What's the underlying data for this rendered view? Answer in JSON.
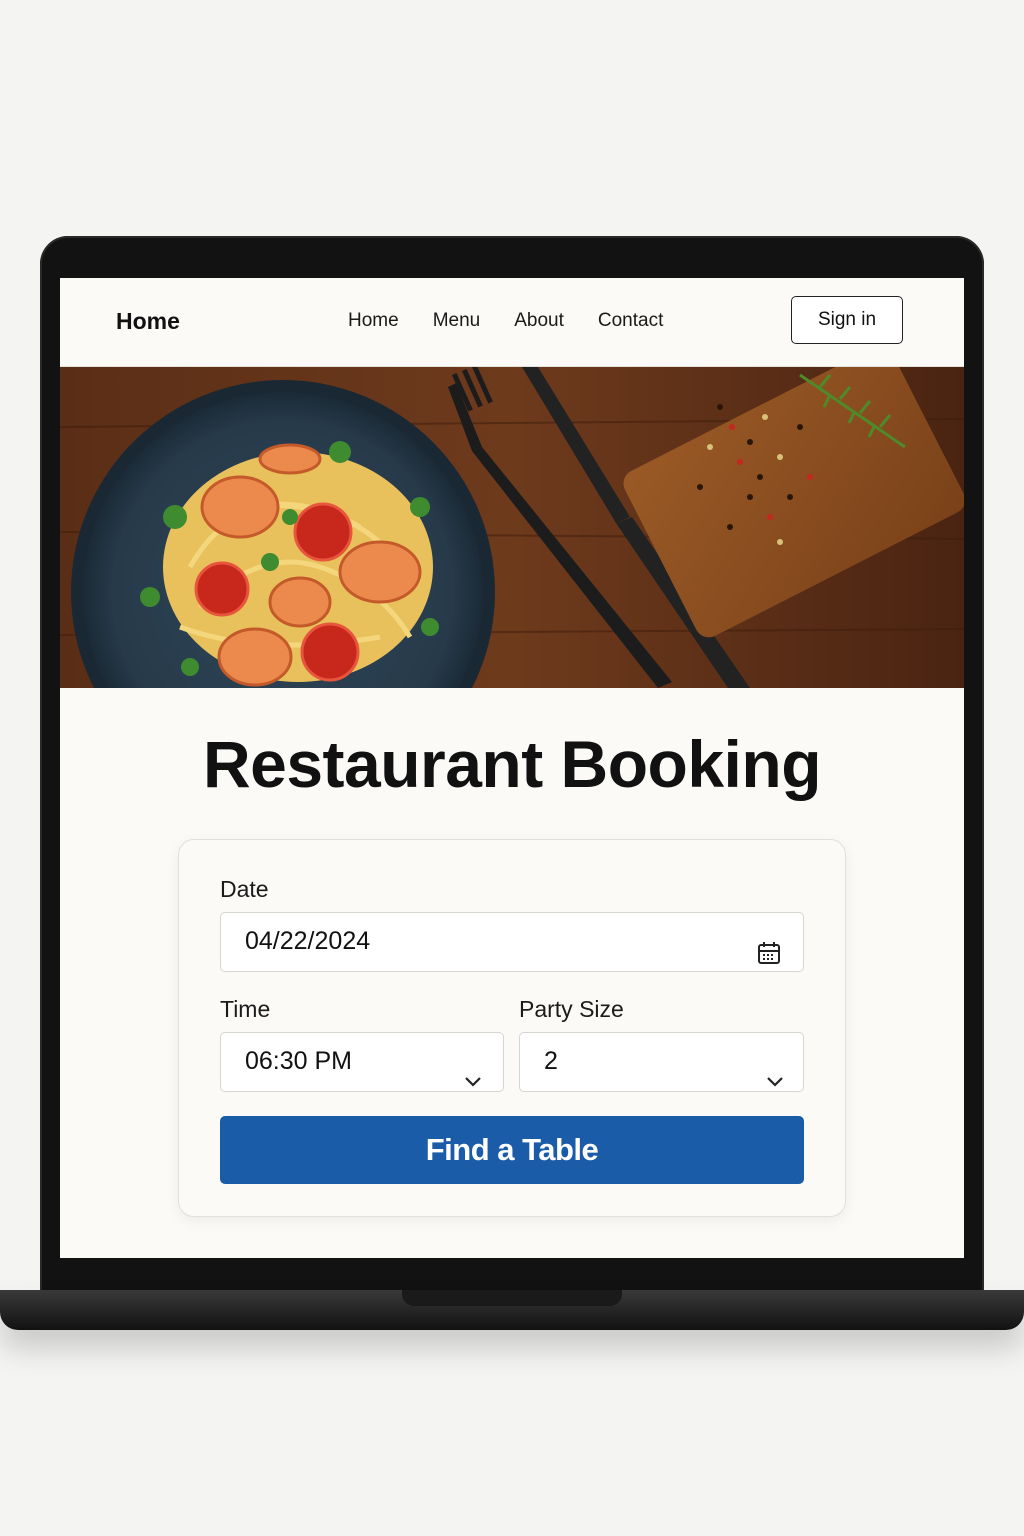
{
  "nav": {
    "brand": "Home",
    "links": [
      "Home",
      "Menu",
      "About",
      "Contact"
    ],
    "signin_label": "Sign in"
  },
  "hero": {
    "image": "pasta-shrimp-dinner-photo"
  },
  "page": {
    "title": "Restaurant Booking"
  },
  "form": {
    "date_label": "Date",
    "date_value": "04/22/2024",
    "time_label": "Time",
    "time_value": "06:30 PM",
    "party_label": "Party Size",
    "party_value": "2",
    "submit_label": "Find a Table"
  },
  "icons": {
    "date": "calendar-icon",
    "select": "chevron-down-icon"
  },
  "colors": {
    "accent": "#1b5ca8",
    "background": "#fbfaf7"
  }
}
